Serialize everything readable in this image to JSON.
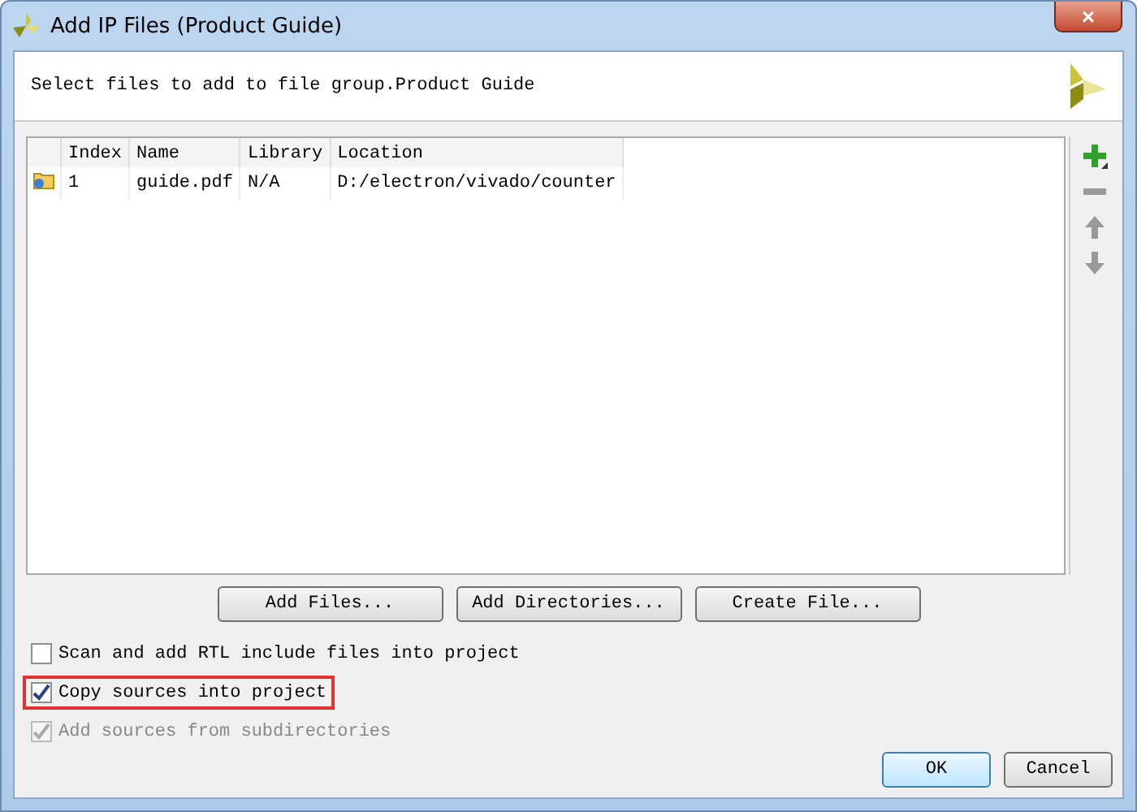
{
  "window": {
    "title": "Add IP Files (Product Guide)",
    "close": "×"
  },
  "header": {
    "text": "Select files to add to file group.Product Guide"
  },
  "table": {
    "columns": [
      "Index",
      "Name",
      "Library",
      "Location"
    ],
    "rows": [
      {
        "cells": [
          "1",
          "guide.pdf",
          "N/A",
          "D:/electron/vivado/counter"
        ],
        "selected": false
      }
    ]
  },
  "side_toolbar": [
    {
      "kind": "add",
      "disabled": false
    },
    {
      "kind": "remove",
      "disabled": true
    },
    {
      "kind": "up",
      "disabled": true
    },
    {
      "kind": "down",
      "disabled": true
    }
  ],
  "buttons": [
    "Add Files...",
    "Add Directories...",
    "Create File..."
  ],
  "options": [
    {
      "label": "Scan and add RTL include files into project",
      "checked": false,
      "disabled": false,
      "highlighted": false
    },
    {
      "label": "Copy sources into project",
      "checked": true,
      "disabled": false,
      "highlighted": true
    },
    {
      "label": "Add sources from subdirectories",
      "checked": true,
      "disabled": true,
      "highlighted": false
    }
  ],
  "footer_buttons": [
    {
      "label": "OK",
      "default": true
    },
    {
      "label": "Cancel",
      "default": false
    }
  ]
}
